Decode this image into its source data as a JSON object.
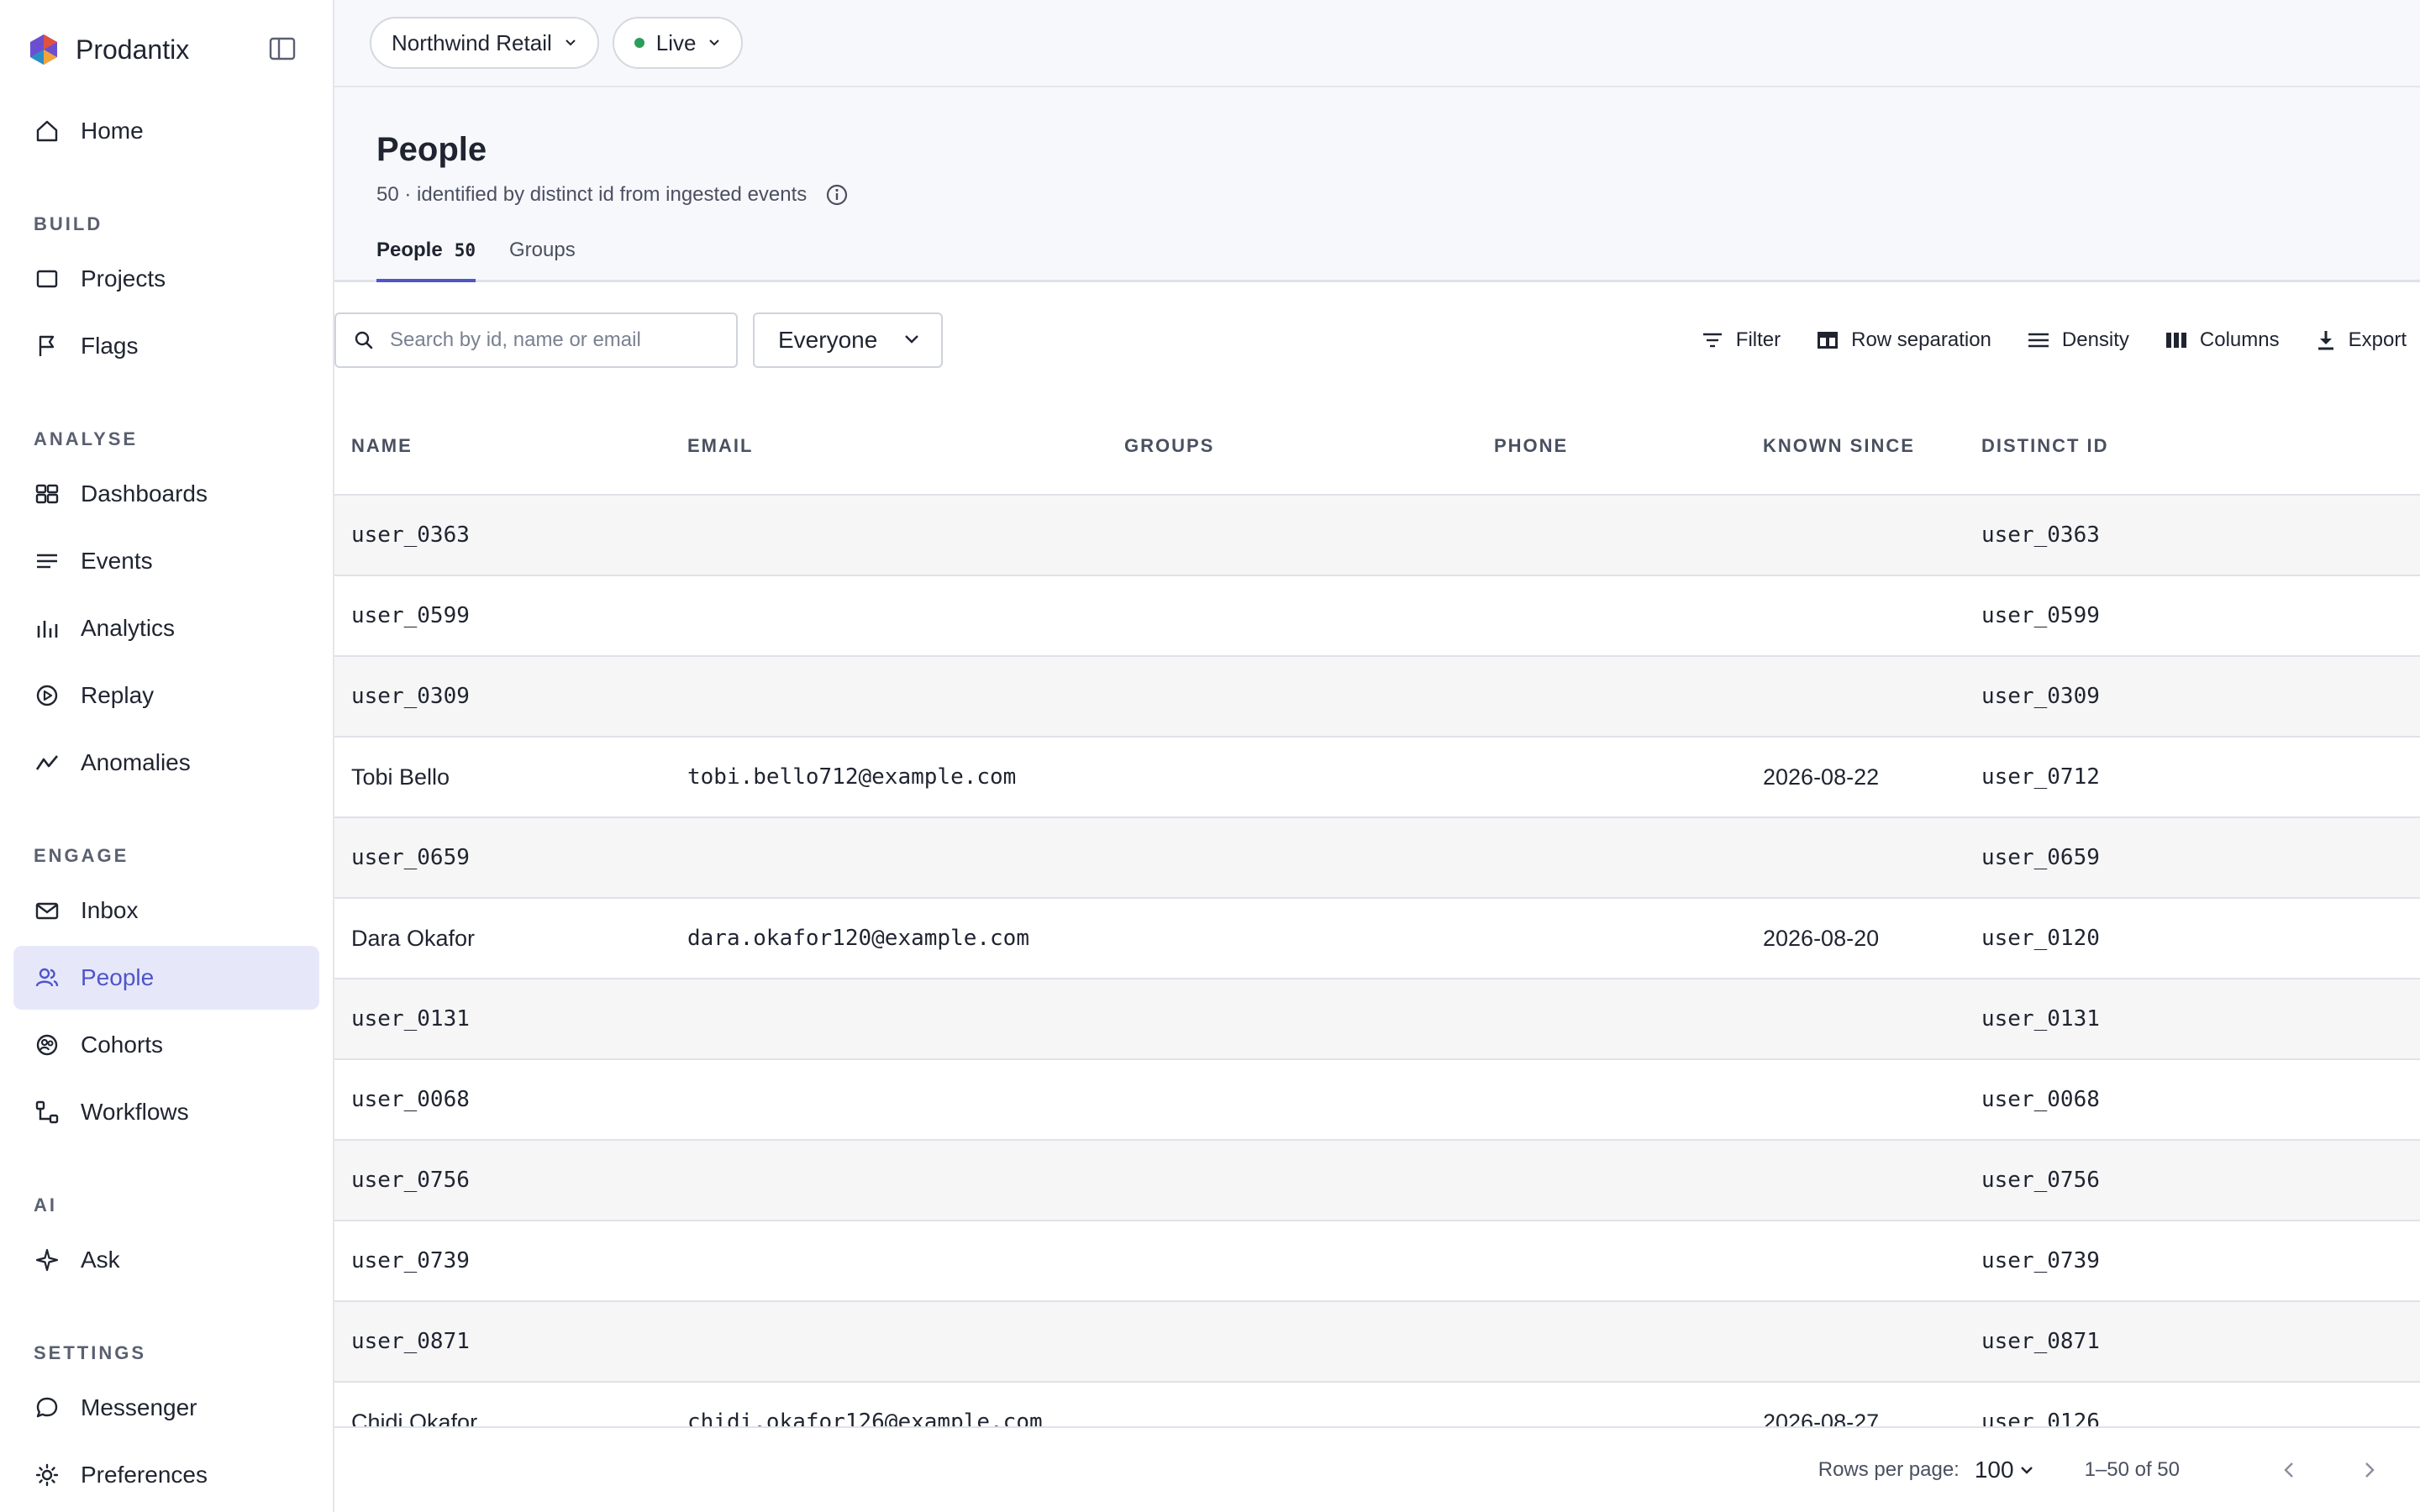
{
  "brand": {
    "name": "Prodantix"
  },
  "sidebar": {
    "home": {
      "label": "Home"
    },
    "sections": [
      {
        "title": "BUILD",
        "items": [
          {
            "label": "Projects"
          },
          {
            "label": "Flags"
          }
        ]
      },
      {
        "title": "ANALYSE",
        "items": [
          {
            "label": "Dashboards"
          },
          {
            "label": "Events"
          },
          {
            "label": "Analytics"
          },
          {
            "label": "Replay"
          },
          {
            "label": "Anomalies"
          }
        ]
      },
      {
        "title": "ENGAGE",
        "items": [
          {
            "label": "Inbox"
          },
          {
            "label": "People"
          },
          {
            "label": "Cohorts"
          },
          {
            "label": "Workflows"
          }
        ]
      },
      {
        "title": "AI",
        "items": [
          {
            "label": "Ask"
          }
        ]
      },
      {
        "title": "SETTINGS",
        "items": [
          {
            "label": "Messenger"
          },
          {
            "label": "Preferences"
          }
        ]
      }
    ]
  },
  "topbar": {
    "workspace": "Northwind Retail",
    "environment": "Live"
  },
  "page": {
    "title": "People",
    "subtitle": "50 · identified by distinct id from ingested events",
    "tabs": [
      {
        "label": "People",
        "count": "50"
      },
      {
        "label": "Groups"
      }
    ]
  },
  "toolbar": {
    "search_placeholder": "Search by id, name or email",
    "segment": "Everyone",
    "filter": "Filter",
    "row_separation": "Row separation",
    "density": "Density",
    "columns": "Columns",
    "export": "Export"
  },
  "table": {
    "headers": {
      "name": "NAME",
      "email": "EMAIL",
      "groups": "GROUPS",
      "phone": "PHONE",
      "known": "KNOWN SINCE",
      "did": "DISTINCT ID"
    },
    "rows": [
      {
        "name": "user_0363",
        "email": "",
        "known": "",
        "did": "user_0363"
      },
      {
        "name": "user_0599",
        "email": "",
        "known": "",
        "did": "user_0599"
      },
      {
        "name": "user_0309",
        "email": "",
        "known": "",
        "did": "user_0309"
      },
      {
        "name": "Tobi Bello",
        "email": "tobi.bello712@example.com",
        "known": "2026-08-22",
        "did": "user_0712"
      },
      {
        "name": "user_0659",
        "email": "",
        "known": "",
        "did": "user_0659"
      },
      {
        "name": "Dara Okafor",
        "email": "dara.okafor120@example.com",
        "known": "2026-08-20",
        "did": "user_0120"
      },
      {
        "name": "user_0131",
        "email": "",
        "known": "",
        "did": "user_0131"
      },
      {
        "name": "user_0068",
        "email": "",
        "known": "",
        "did": "user_0068"
      },
      {
        "name": "user_0756",
        "email": "",
        "known": "",
        "did": "user_0756"
      },
      {
        "name": "user_0739",
        "email": "",
        "known": "",
        "did": "user_0739"
      },
      {
        "name": "user_0871",
        "email": "",
        "known": "",
        "did": "user_0871"
      },
      {
        "name": "Chidi Okafor",
        "email": "chidi.okafor126@example.com",
        "known": "2026-08-27",
        "did": "user_0126"
      }
    ]
  },
  "footer": {
    "rows_per_page_label": "Rows per page:",
    "rows_per_page": "100",
    "range": "1–50 of 50"
  },
  "colors": {
    "accent": "#4f55c9",
    "active_bg": "#e6e8fa",
    "live": "#2e9d5b"
  }
}
